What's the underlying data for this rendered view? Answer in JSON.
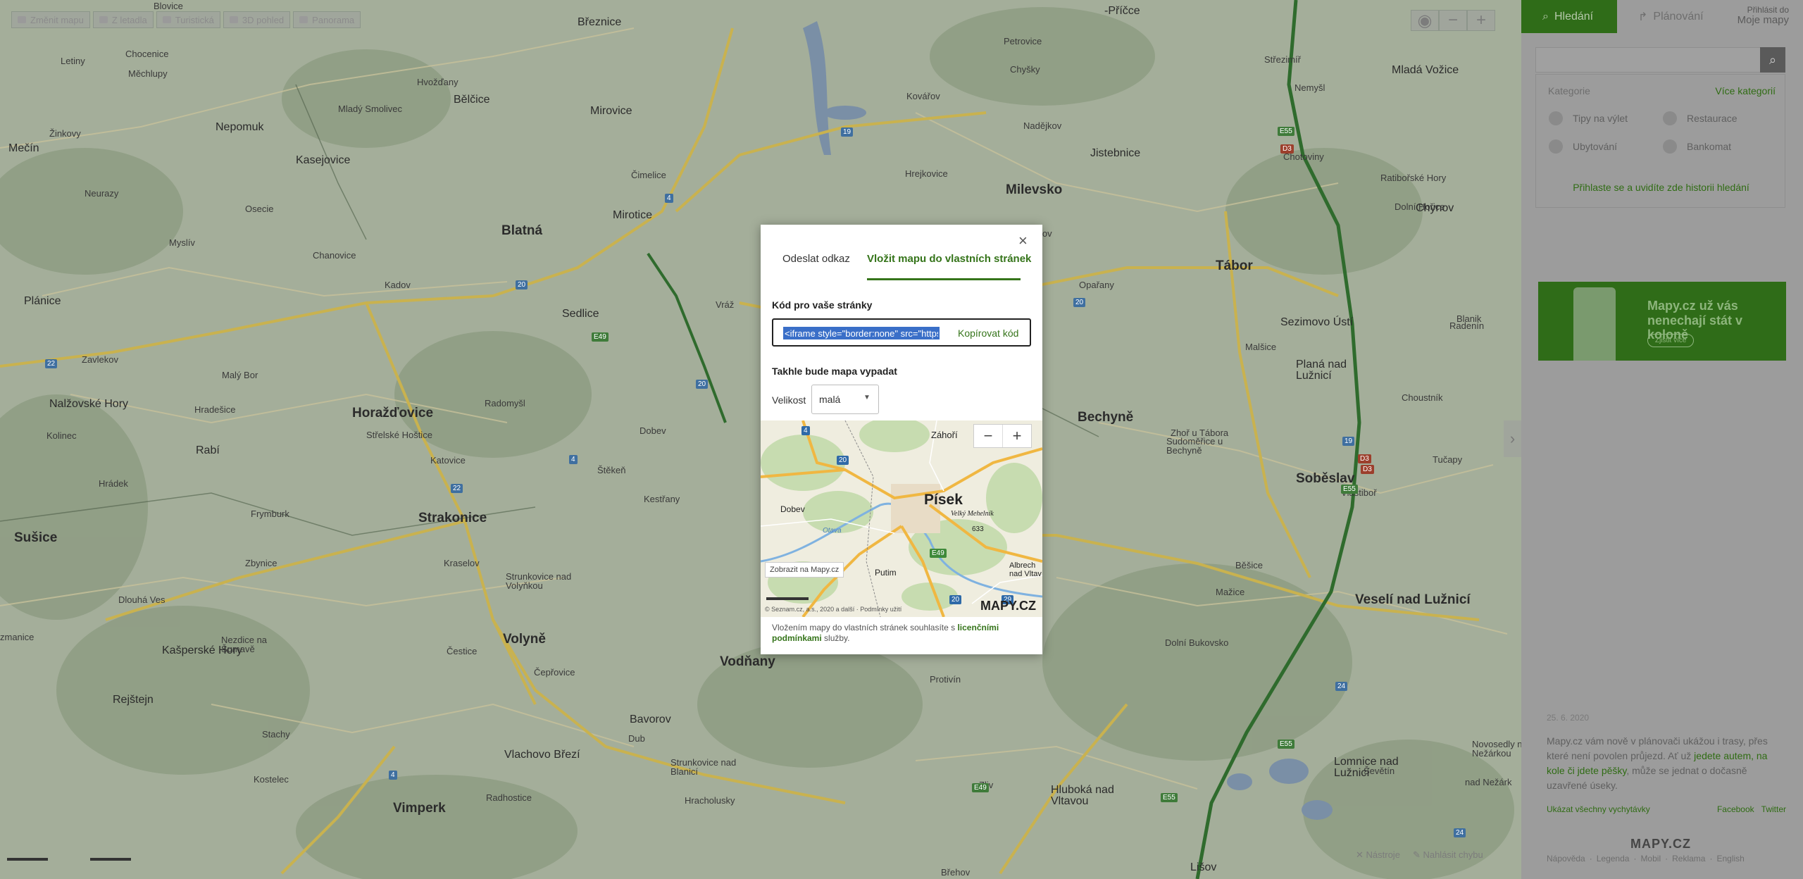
{
  "map": {
    "toolbar": [
      {
        "label": "Změnit mapu",
        "icon": "layers-icon"
      },
      {
        "label": "Z letadla",
        "icon": "plane-icon"
      },
      {
        "label": "Turistická",
        "icon": "mountain-icon"
      },
      {
        "label": "3D pohled",
        "icon": "globe-icon"
      },
      {
        "label": "Panorama",
        "icon": "camera-icon"
      }
    ],
    "zoom_in": "+",
    "zoom_out": "−",
    "tools_label": "Nástroje",
    "report_label": "Nahlásit chybu",
    "places": [
      {
        "name": "Blovice",
        "cls": "p-vil"
      },
      {
        "name": "Březnice",
        "cls": "p-town"
      },
      {
        "name": "-Příčce",
        "cls": "p-town"
      },
      {
        "name": "Letiny",
        "cls": "p-vil"
      },
      {
        "name": "Chocenice",
        "cls": "p-vil"
      },
      {
        "name": "Měchlupy",
        "cls": "p-vil"
      },
      {
        "name": "Hvožďany",
        "cls": "p-vil"
      },
      {
        "name": "Bělčice",
        "cls": "p-town"
      },
      {
        "name": "Mladý Smolivec",
        "cls": "p-vil"
      },
      {
        "name": "Nepomuk",
        "cls": "p-town"
      },
      {
        "name": "Mirovice",
        "cls": "p-town"
      },
      {
        "name": "Petrovice",
        "cls": "p-vil"
      },
      {
        "name": "Chyšky",
        "cls": "p-vil"
      },
      {
        "name": "Střezimíř",
        "cls": "p-vil"
      },
      {
        "name": "Mladá Vožice",
        "cls": "p-town"
      },
      {
        "name": "Mečín",
        "cls": "p-town"
      },
      {
        "name": "Kasejovice",
        "cls": "p-town"
      },
      {
        "name": "Žinkovy",
        "cls": "p-vil"
      },
      {
        "name": "Kovářov",
        "cls": "p-vil"
      },
      {
        "name": "Nadějkov",
        "cls": "p-vil"
      },
      {
        "name": "Nemyšl",
        "cls": "p-vil"
      },
      {
        "name": "Jistebnice",
        "cls": "p-town"
      },
      {
        "name": "Chotoviny",
        "cls": "p-vil"
      },
      {
        "name": "Milevsko",
        "cls": "p-city"
      },
      {
        "name": "Čimelice",
        "cls": "p-vil"
      },
      {
        "name": "Hrejkovice",
        "cls": "p-vil"
      },
      {
        "name": "Neurazy",
        "cls": "p-vil"
      },
      {
        "name": "Osecie",
        "cls": "p-vil"
      },
      {
        "name": "Ratibořské Hory",
        "cls": "p-vil"
      },
      {
        "name": "Mirotice",
        "cls": "p-town"
      },
      {
        "name": "Dolní Hořice",
        "cls": "p-vil"
      },
      {
        "name": "Blatná",
        "cls": "p-city"
      },
      {
        "name": "Chynov",
        "cls": "p-town"
      },
      {
        "name": "Sepekov",
        "cls": "p-vil"
      },
      {
        "name": "Tábor",
        "cls": "p-city"
      },
      {
        "name": "Myslív",
        "cls": "p-vil"
      },
      {
        "name": "Chanovice",
        "cls": "p-vil"
      },
      {
        "name": "Kadov",
        "cls": "p-vil"
      },
      {
        "name": "Opařany",
        "cls": "p-vil"
      },
      {
        "name": "Plánice",
        "cls": "p-town"
      },
      {
        "name": "Sedlice",
        "cls": "p-town"
      },
      {
        "name": "Vráž",
        "cls": "p-vil"
      },
      {
        "name": "Sezimovo Ústí",
        "cls": "p-town"
      },
      {
        "name": "Radenín",
        "cls": "p-vil"
      },
      {
        "name": "Malšice",
        "cls": "p-vil"
      },
      {
        "name": "Zavlekov",
        "cls": "p-vil"
      },
      {
        "name": "Planá nad Lužnicí",
        "cls": "p-town"
      },
      {
        "name": "Malý Bor",
        "cls": "p-vil"
      },
      {
        "name": "Nalžovské Hory",
        "cls": "p-town"
      },
      {
        "name": "Hradešice",
        "cls": "p-vil"
      },
      {
        "name": "Horažďovice",
        "cls": "p-city"
      },
      {
        "name": "Radomyšl",
        "cls": "p-vil"
      },
      {
        "name": "Bechyně",
        "cls": "p-city"
      },
      {
        "name": "Choustník",
        "cls": "p-vil"
      },
      {
        "name": "Dobev",
        "cls": "p-vil"
      },
      {
        "name": "Střelské Hoštice",
        "cls": "p-vil"
      },
      {
        "name": "Rabí",
        "cls": "p-town"
      },
      {
        "name": "Kolinec",
        "cls": "p-vil"
      },
      {
        "name": "Zhoř u Tábora",
        "cls": "p-vil"
      },
      {
        "name": "Sudoměřice u Bechyně",
        "cls": "p-vil"
      },
      {
        "name": "Soběslav",
        "cls": "p-city"
      },
      {
        "name": "Katovice",
        "cls": "p-vil"
      },
      {
        "name": "Tučapy",
        "cls": "p-vil"
      },
      {
        "name": "Hrádek",
        "cls": "p-vil"
      },
      {
        "name": "Štěkeň",
        "cls": "p-vil"
      },
      {
        "name": "Kestřany",
        "cls": "p-vil"
      },
      {
        "name": "Vlastiboř",
        "cls": "p-vil"
      },
      {
        "name": "Frymburk",
        "cls": "p-vil"
      },
      {
        "name": "Strakonice",
        "cls": "p-city"
      },
      {
        "name": "Sušice",
        "cls": "p-city"
      },
      {
        "name": "Kraselov",
        "cls": "p-vil"
      },
      {
        "name": "Zbynice",
        "cls": "p-vil"
      },
      {
        "name": "Běšice",
        "cls": "p-vil"
      },
      {
        "name": "Strunkovice nad Volyňkou",
        "cls": "p-vil"
      },
      {
        "name": "Mažice",
        "cls": "p-vil"
      },
      {
        "name": "Veselí nad Lužnicí",
        "cls": "p-city"
      },
      {
        "name": "Dlouhá Ves",
        "cls": "p-vil"
      },
      {
        "name": "Volyně",
        "cls": "p-city"
      },
      {
        "name": "Kašperské Hory",
        "cls": "p-town"
      },
      {
        "name": "Nezdice na Šumavě",
        "cls": "p-vil"
      },
      {
        "name": "Čestice",
        "cls": "p-vil"
      },
      {
        "name": "Vodňany",
        "cls": "p-city"
      },
      {
        "name": "Dolní Bukovsko",
        "cls": "p-vil"
      },
      {
        "name": "Čepřovice",
        "cls": "p-vil"
      },
      {
        "name": "Protivín",
        "cls": "p-vil"
      },
      {
        "name": "Rejštejn",
        "cls": "p-town"
      },
      {
        "name": "Bavorov",
        "cls": "p-town"
      },
      {
        "name": "Dub",
        "cls": "p-vil"
      },
      {
        "name": "Stachy",
        "cls": "p-vil"
      },
      {
        "name": "Vlachovo Březí",
        "cls": "p-town"
      },
      {
        "name": "Strunkovice nad Blanicí",
        "cls": "p-vil"
      },
      {
        "name": "Novosedly nad Nežárkou",
        "cls": "p-vil"
      },
      {
        "name": "Lomnice nad Lužnicí",
        "cls": "p-town"
      },
      {
        "name": "Radhostice",
        "cls": "p-vil"
      },
      {
        "name": "Hracholusky",
        "cls": "p-vil"
      },
      {
        "name": "Ševětín",
        "cls": "p-vil"
      },
      {
        "name": "Vimperk",
        "cls": "p-city"
      },
      {
        "name": "Zliv",
        "cls": "p-vil"
      },
      {
        "name": "Hluboká nad Vltavou",
        "cls": "p-town"
      },
      {
        "name": "Lišov",
        "cls": "p-town"
      },
      {
        "name": "Břehov",
        "cls": "p-vil"
      },
      {
        "name": "nad Nežárk",
        "cls": "p-vil"
      },
      {
        "name": "zmanice",
        "cls": "p-vil"
      },
      {
        "name": "Kostelec",
        "cls": "p-vil"
      },
      {
        "name": "Blanik",
        "cls": "p-vil"
      }
    ],
    "shields": [
      "19",
      "4",
      "20",
      "20",
      "E49",
      "20",
      "22",
      "4",
      "22",
      "24",
      "E55",
      "D3",
      "19",
      "D3",
      "D3",
      "E55",
      "E55",
      "24",
      "4",
      "E55",
      "E49"
    ]
  },
  "side_panel": {
    "tabs": [
      {
        "label": "Hledání",
        "icon": "search-icon"
      },
      {
        "label": "Plánování",
        "icon": "route-icon"
      }
    ],
    "login_top": "Přihlásit do",
    "login_main": "Moje mapy",
    "search_placeholder": "",
    "categories_title": "Kategorie",
    "categories_more": "Více kategorií",
    "categories": [
      {
        "label": "Tipy na výlet",
        "icon": "trip-icon"
      },
      {
        "label": "Restaurace",
        "icon": "restaurant-icon"
      },
      {
        "label": "Ubytování",
        "icon": "bed-icon"
      },
      {
        "label": "Bankomat",
        "icon": "atm-icon"
      }
    ],
    "history_link": "Přihlaste se",
    "history_text": " a uvidíte zde historii hledání",
    "ad_text": "Mapy.cz už vás nenechají stát v koloně",
    "ad_button": "Zjistit více",
    "news_date": "25. 6. 2020",
    "news_text_1": "Mapy.cz vám nově v plánovači ukážou i trasy, přes které není povolen průjezd. Ať už ",
    "news_link": "jedete autem, na kole či jdete pěšky",
    "news_text_2": ", může se jednat o dočasně uzavřené úseky.",
    "news_all": "Ukázat všechny vychytávky",
    "news_facebook": "Facebook",
    "news_twitter": "Twitter",
    "logo": "MAPY.CZ",
    "footer": [
      "Nápověda",
      "Legenda",
      "Mobil",
      "Reklama",
      "English"
    ]
  },
  "modal": {
    "tabs": [
      "Odeslat odkaz",
      "Vložit mapu do vlastních stránek"
    ],
    "code_label": "Kód pro vaše stránky",
    "code_value": "<iframe style=\"border:none\" src=\"https://frame.mapy.cz/",
    "copy_button": "Kopírovat kód",
    "preview_label": "Takhle bude mapa vypadat",
    "size_label": "Velikost",
    "size_value": "malá",
    "preview_places": [
      {
        "name": "Záhoří"
      },
      {
        "name": "Písek"
      },
      {
        "name": "Velký Mehelník"
      },
      {
        "name": "633"
      },
      {
        "name": "Dobev"
      },
      {
        "name": "Putim"
      },
      {
        "name": "Albrech nad Vltav"
      },
      {
        "name": "Otava"
      }
    ],
    "preview_shields": [
      "20",
      "E49",
      "20",
      "29",
      "4"
    ],
    "preview_show": "Zobrazit na Mapy.cz",
    "preview_copyright": "© Seznam.cz, a.s., 2020 a další · Podmínky užití",
    "preview_logo": "MAPY.CZ",
    "note_prefix": "Vložením mapy do vlastních stránek souhlasíte s ",
    "note_link": "licenčními podmínkami",
    "note_suffix": " služby.",
    "close": "×"
  }
}
